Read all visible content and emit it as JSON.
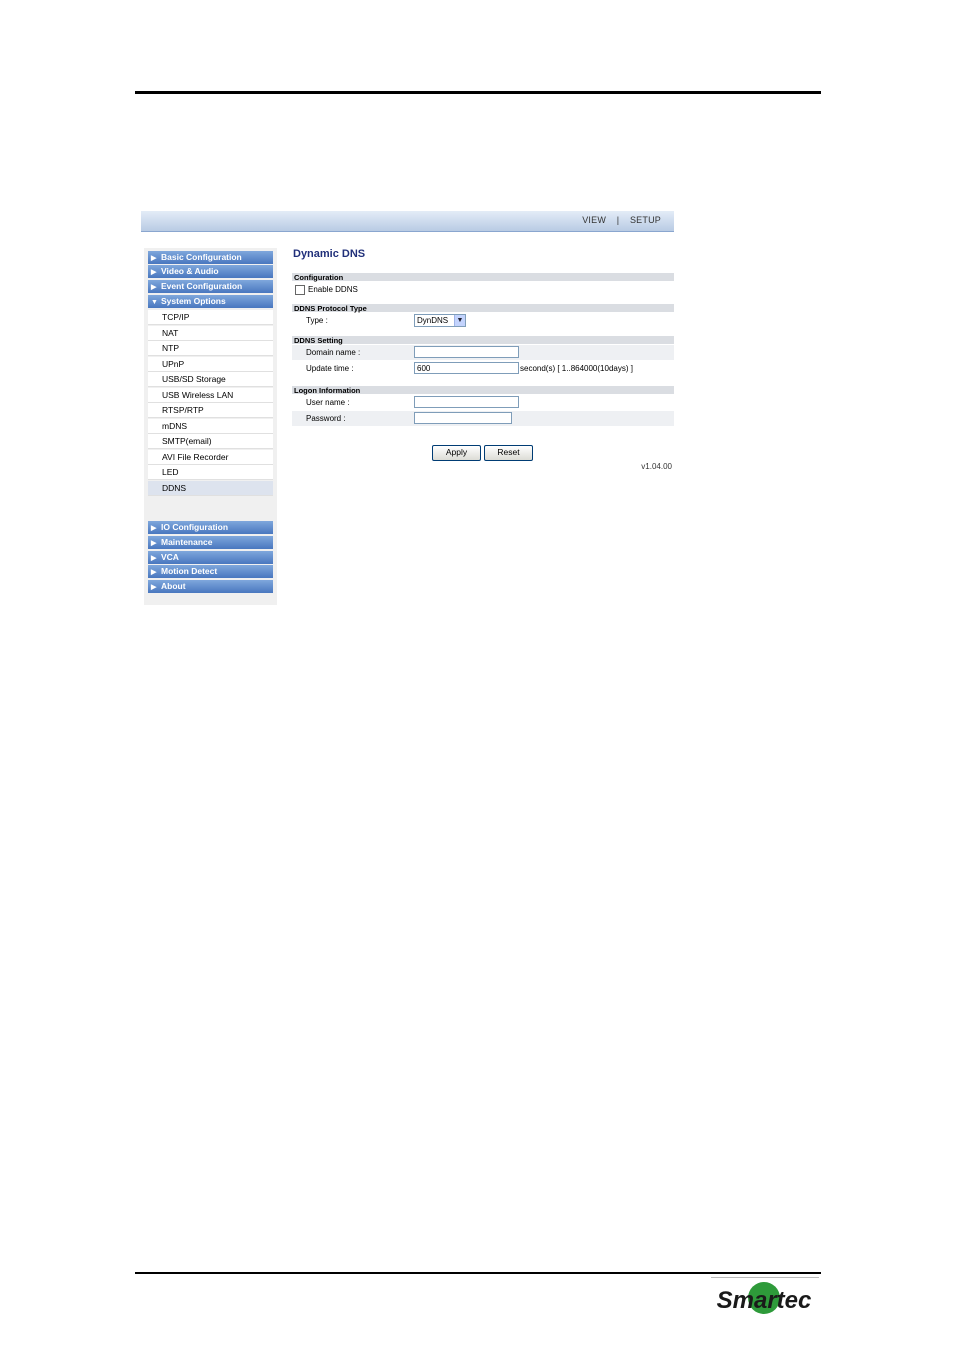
{
  "topnav": {
    "view": "VIEW",
    "separator": "|",
    "setup": "SETUP"
  },
  "sidebar": {
    "groups_top": [
      {
        "label": "Basic Configuration",
        "arrow": "▶"
      },
      {
        "label": "Video & Audio",
        "arrow": "▶"
      },
      {
        "label": "Event Configuration",
        "arrow": "▶"
      },
      {
        "label": "System Options",
        "arrow": "▼"
      }
    ],
    "items": [
      "TCP/IP",
      "NAT",
      "NTP",
      "UPnP",
      "USB/SD Storage",
      "USB Wireless LAN",
      "RTSP/RTP",
      "mDNS",
      "SMTP(email)",
      "AVI File Recorder",
      "LED",
      "DDNS"
    ],
    "groups_bottom": [
      {
        "label": "IO Configuration",
        "arrow": "▶"
      },
      {
        "label": "Maintenance",
        "arrow": "▶"
      },
      {
        "label": "VCA",
        "arrow": "▶"
      },
      {
        "label": "Motion Detect",
        "arrow": "▶"
      },
      {
        "label": "About",
        "arrow": "▶"
      }
    ]
  },
  "main": {
    "title": "Dynamic DNS",
    "configuration": {
      "header": "Configuration",
      "enable_label": "Enable DDNS"
    },
    "protocol": {
      "header": "DDNS Protocol Type",
      "type_label": "Type :",
      "type_value": "DynDNS"
    },
    "setting": {
      "header": "DDNS Setting",
      "domain_label": "Domain name :",
      "domain_value": "",
      "update_label": "Update time :",
      "update_value": "600",
      "update_hint": "second(s) [ 1..864000(10days) ]"
    },
    "logon": {
      "header": "Logon Information",
      "user_label": "User name :",
      "user_value": "",
      "password_label": "Password :",
      "password_value": ""
    },
    "apply_label": "Apply",
    "reset_label": "Reset",
    "version": "v1.04.00"
  },
  "logo": {
    "text": "Smartec",
    "colors": {
      "text": "#1a1a1a",
      "accent": "#2e9a3a"
    }
  }
}
